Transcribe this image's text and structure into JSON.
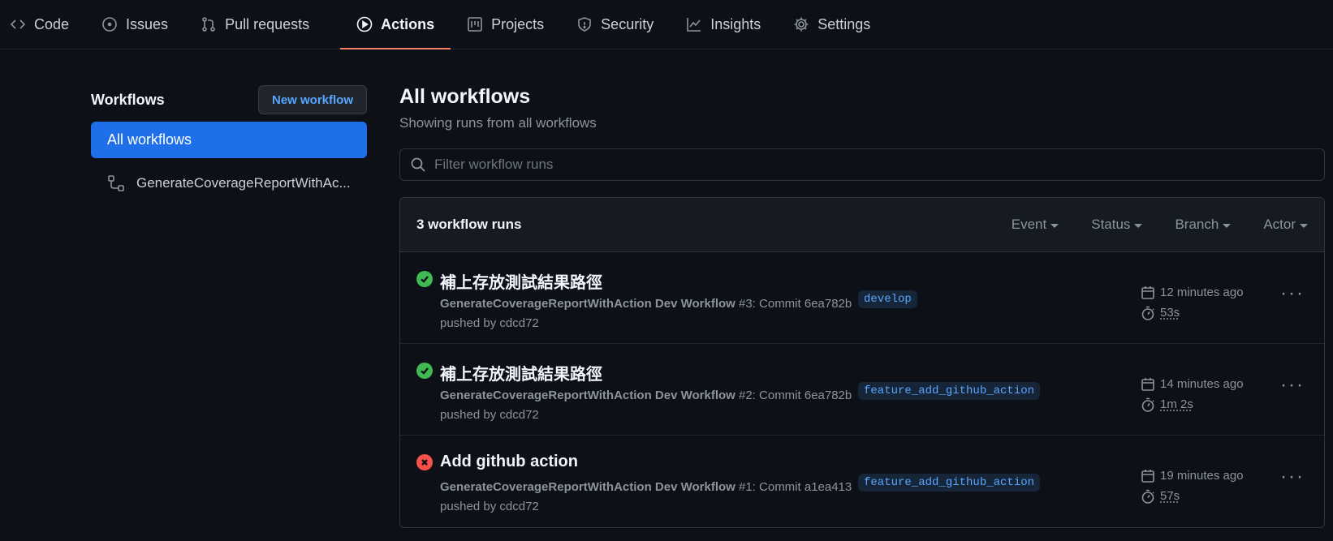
{
  "nav": {
    "tabs": [
      {
        "label": "Code",
        "icon": "code-icon"
      },
      {
        "label": "Issues",
        "icon": "issue-icon"
      },
      {
        "label": "Pull requests",
        "icon": "pull-request-icon"
      },
      {
        "label": "Actions",
        "icon": "play-icon",
        "active": true
      },
      {
        "label": "Projects",
        "icon": "project-icon"
      },
      {
        "label": "Security",
        "icon": "shield-icon"
      },
      {
        "label": "Insights",
        "icon": "graph-icon"
      },
      {
        "label": "Settings",
        "icon": "gear-icon"
      }
    ]
  },
  "sidebar": {
    "title": "Workflows",
    "new_button": "New workflow",
    "items": [
      {
        "label": "All workflows",
        "active": true
      },
      {
        "label": "GenerateCoverageReportWithAc..."
      }
    ]
  },
  "main": {
    "title": "All workflows",
    "subtitle": "Showing runs from all workflows",
    "filter_placeholder": "Filter workflow runs",
    "count": "3 workflow runs",
    "filters": [
      "Event",
      "Status",
      "Branch",
      "Actor"
    ],
    "runs": [
      {
        "status": "success",
        "title": "補上存放測試結果路徑",
        "workflow": "GenerateCoverageReportWithAction Dev Workflow",
        "detail": " #3: Commit 6ea782b",
        "pushed": "pushed by cdcd72",
        "branch": "develop",
        "ago": "12 minutes ago",
        "duration": "53s"
      },
      {
        "status": "success",
        "title": "補上存放測試結果路徑",
        "workflow": "GenerateCoverageReportWithAction Dev Workflow",
        "detail": " #2: Commit 6ea782b",
        "pushed": "pushed by cdcd72",
        "branch": "feature_add_github_action",
        "ago": "14 minutes ago",
        "duration": "1m 2s"
      },
      {
        "status": "failure",
        "title": "Add github action",
        "workflow": "GenerateCoverageReportWithAction Dev Workflow",
        "detail": " #1: Commit a1ea413",
        "pushed": "pushed by cdcd72",
        "branch": "feature_add_github_action",
        "ago": "19 minutes ago",
        "duration": "57s"
      }
    ]
  },
  "colors": {
    "background": "#0d1117",
    "accent": "#1f6feb",
    "active_tab_underline": "#f78166",
    "success": "#3fb950",
    "failure": "#f85149",
    "branch_text": "#58a6ff"
  }
}
